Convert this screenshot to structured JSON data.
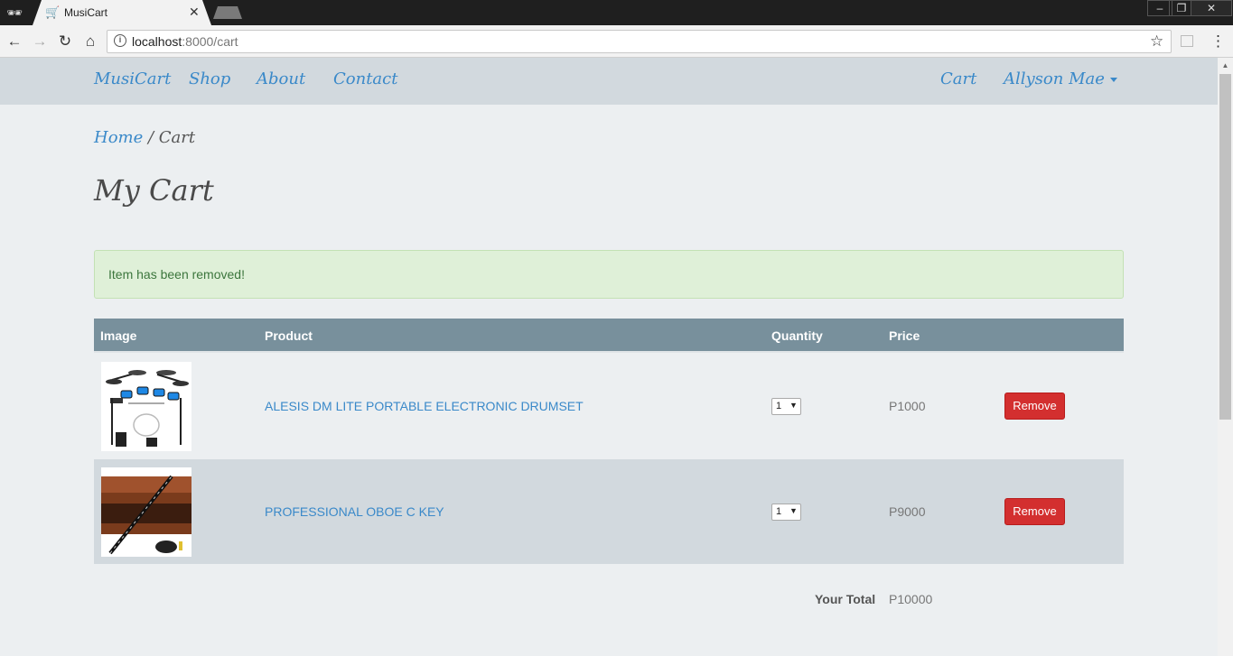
{
  "browser": {
    "tab_title": "MusiCart",
    "url_host": "localhost",
    "url_path": ":8000/cart"
  },
  "navbar": {
    "brand": "MusiCart",
    "links": [
      "Shop",
      "About",
      "Contact"
    ],
    "cart": "Cart",
    "user": "Allyson Mae"
  },
  "breadcrumb": {
    "home": "Home",
    "separator": " / ",
    "current": "Cart"
  },
  "page_title": "My Cart",
  "alert": {
    "message": "Item has been removed!"
  },
  "table": {
    "headers": [
      "Image",
      "Product",
      "Quantity",
      "Price",
      ""
    ],
    "rows": [
      {
        "product": "ALESIS DM LITE PORTABLE ELECTRONIC DRUMSET",
        "quantity": "1",
        "price": "P1000",
        "action": "Remove"
      },
      {
        "product": "PROFESSIONAL OBOE C KEY",
        "quantity": "1",
        "price": "P9000",
        "action": "Remove"
      }
    ]
  },
  "total": {
    "label": "Your Total",
    "value": "P10000"
  },
  "colors": {
    "navbar_bg": "#d2d9de",
    "link": "#3a89c9",
    "table_header": "#78909c",
    "remove_button": "#d32f2f",
    "alert_bg": "#dff0d8"
  }
}
